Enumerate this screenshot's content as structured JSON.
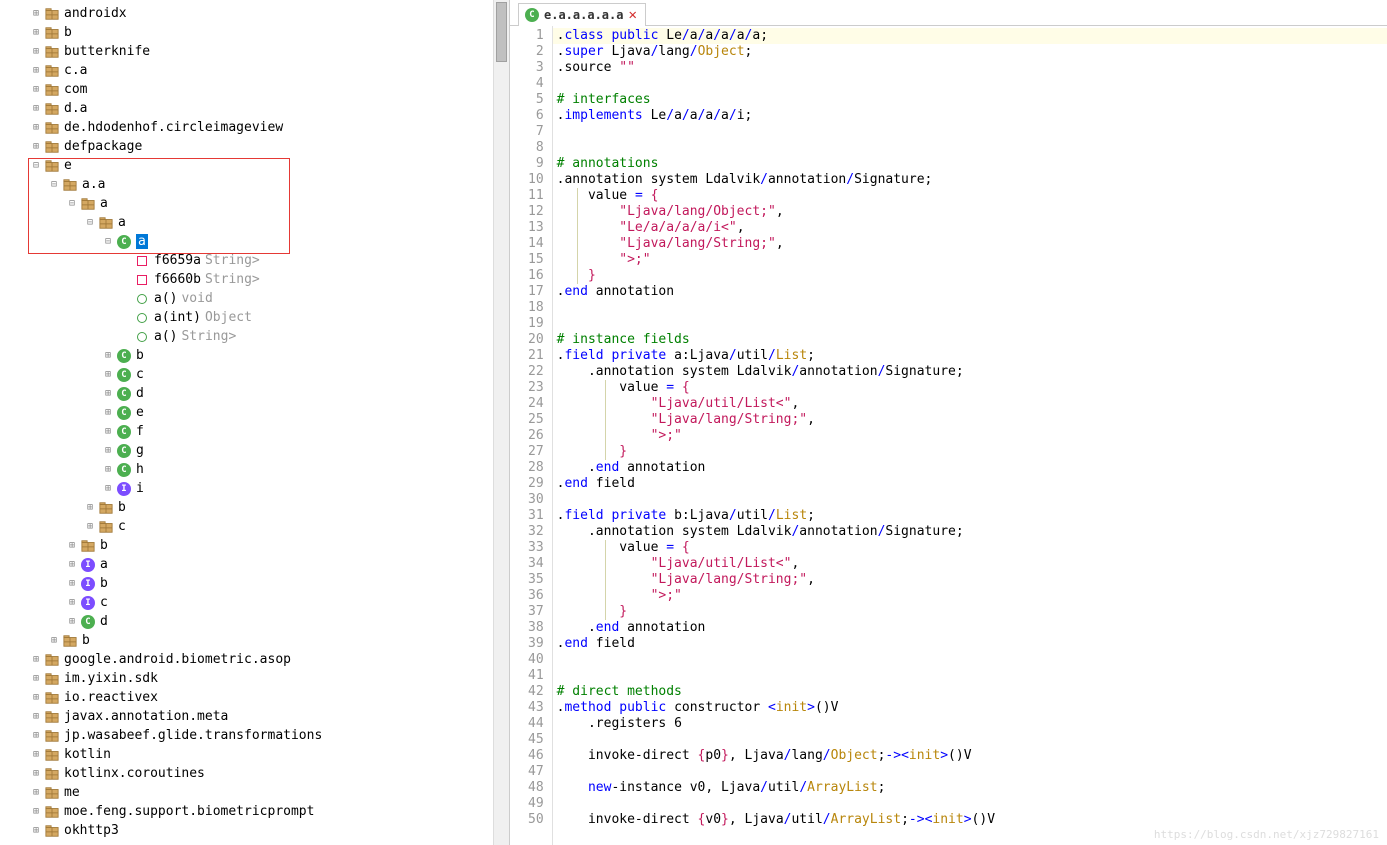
{
  "tree": {
    "top": [
      {
        "label": "androidx",
        "icon": "pkg",
        "exp": "plus"
      },
      {
        "label": "b",
        "icon": "pkg",
        "exp": "plus"
      },
      {
        "label": "butterknife",
        "icon": "pkg",
        "exp": "plus"
      },
      {
        "label": "c.a",
        "icon": "pkg",
        "exp": "plus"
      },
      {
        "label": "com",
        "icon": "pkg",
        "exp": "plus"
      },
      {
        "label": "d.a",
        "icon": "pkg",
        "exp": "plus"
      },
      {
        "label": "de.hdodenhof.circleimageview",
        "icon": "pkg",
        "exp": "plus"
      },
      {
        "label": "defpackage",
        "icon": "pkg",
        "exp": "plus"
      }
    ],
    "e_label": "e",
    "aa_label": "a.a",
    "a1_label": "a",
    "a2_label": "a",
    "a3_label": "a",
    "members": [
      {
        "label": "f6659a",
        "hint": "String>",
        "icon": "field"
      },
      {
        "label": "f6660b",
        "hint": "String>",
        "icon": "field"
      },
      {
        "label": "a()",
        "hint": "void",
        "icon": "method"
      },
      {
        "label": "a(int)",
        "hint": "Object",
        "icon": "method"
      },
      {
        "label": "a()",
        "hint": "String>",
        "icon": "method"
      }
    ],
    "siblings_c": [
      {
        "label": "b",
        "icon": "class"
      },
      {
        "label": "c",
        "icon": "class"
      },
      {
        "label": "d",
        "icon": "class"
      },
      {
        "label": "e",
        "icon": "class"
      },
      {
        "label": "f",
        "icon": "class"
      },
      {
        "label": "g",
        "icon": "class"
      },
      {
        "label": "h",
        "icon": "class"
      },
      {
        "label": "i",
        "icon": "interface"
      }
    ],
    "aa_children_tail": [
      {
        "label": "b",
        "icon": "pkg",
        "exp": "plus"
      },
      {
        "label": "c",
        "icon": "pkg",
        "exp": "plus"
      }
    ],
    "e_children_tail": [
      {
        "label": "b",
        "icon": "pkg",
        "exp": "plus"
      },
      {
        "label": "a",
        "icon": "interface",
        "exp": "plus"
      },
      {
        "label": "b",
        "icon": "interface",
        "exp": "plus"
      },
      {
        "label": "c",
        "icon": "interface",
        "exp": "plus"
      },
      {
        "label": "d",
        "icon": "class",
        "exp": "plus"
      }
    ],
    "root_tail": [
      {
        "label": "b",
        "icon": "pkg",
        "exp": "plus"
      }
    ],
    "bottom": [
      {
        "label": "google.android.biometric.asop",
        "icon": "pkg",
        "exp": "plus"
      },
      {
        "label": "im.yixin.sdk",
        "icon": "pkg",
        "exp": "plus"
      },
      {
        "label": "io.reactivex",
        "icon": "pkg",
        "exp": "plus"
      },
      {
        "label": "javax.annotation.meta",
        "icon": "pkg",
        "exp": "plus"
      },
      {
        "label": "jp.wasabeef.glide.transformations",
        "icon": "pkg",
        "exp": "plus"
      },
      {
        "label": "kotlin",
        "icon": "pkg",
        "exp": "plus"
      },
      {
        "label": "kotlinx.coroutines",
        "icon": "pkg",
        "exp": "plus"
      },
      {
        "label": "me",
        "icon": "pkg",
        "exp": "plus"
      },
      {
        "label": "moe.feng.support.biometricprompt",
        "icon": "pkg",
        "exp": "plus"
      },
      {
        "label": "okhttp3",
        "icon": "pkg",
        "exp": "plus"
      }
    ]
  },
  "tab": {
    "title": "e.a.a.a.a.a"
  },
  "code": [
    {
      "n": 1,
      "hl": true,
      "tokens": [
        {
          "t": ".",
          "c": "punct"
        },
        {
          "t": "class",
          "c": "kw"
        },
        {
          "t": " ",
          "c": ""
        },
        {
          "t": "public",
          "c": "kw"
        },
        {
          "t": " Le",
          "c": ""
        },
        {
          "t": "/",
          "c": "op"
        },
        {
          "t": "a",
          "c": ""
        },
        {
          "t": "/",
          "c": "op"
        },
        {
          "t": "a",
          "c": ""
        },
        {
          "t": "/",
          "c": "op"
        },
        {
          "t": "a",
          "c": ""
        },
        {
          "t": "/",
          "c": "op"
        },
        {
          "t": "a",
          "c": ""
        },
        {
          "t": "/",
          "c": "op"
        },
        {
          "t": "a",
          "c": ""
        },
        {
          "t": ";",
          "c": "punct"
        }
      ]
    },
    {
      "n": 2,
      "tokens": [
        {
          "t": ".",
          "c": "punct"
        },
        {
          "t": "super",
          "c": "kw"
        },
        {
          "t": " Ljava",
          "c": ""
        },
        {
          "t": "/",
          "c": "op"
        },
        {
          "t": "lang",
          "c": ""
        },
        {
          "t": "/",
          "c": "op"
        },
        {
          "t": "Object",
          "c": "typ"
        },
        {
          "t": ";",
          "c": "punct"
        }
      ]
    },
    {
      "n": 3,
      "tokens": [
        {
          "t": ".source ",
          "c": ""
        },
        {
          "t": "\"\"",
          "c": "str"
        }
      ]
    },
    {
      "n": 4,
      "tokens": []
    },
    {
      "n": 5,
      "tokens": [
        {
          "t": "# interfaces",
          "c": "cmt"
        }
      ]
    },
    {
      "n": 6,
      "tokens": [
        {
          "t": ".",
          "c": "punct"
        },
        {
          "t": "implements",
          "c": "kw"
        },
        {
          "t": " Le",
          "c": ""
        },
        {
          "t": "/",
          "c": "op"
        },
        {
          "t": "a",
          "c": ""
        },
        {
          "t": "/",
          "c": "op"
        },
        {
          "t": "a",
          "c": ""
        },
        {
          "t": "/",
          "c": "op"
        },
        {
          "t": "a",
          "c": ""
        },
        {
          "t": "/",
          "c": "op"
        },
        {
          "t": "a",
          "c": ""
        },
        {
          "t": "/",
          "c": "op"
        },
        {
          "t": "i",
          "c": ""
        },
        {
          "t": ";",
          "c": "punct"
        }
      ]
    },
    {
      "n": 7,
      "tokens": []
    },
    {
      "n": 8,
      "tokens": []
    },
    {
      "n": 9,
      "tokens": [
        {
          "t": "# annotations",
          "c": "cmt"
        }
      ]
    },
    {
      "n": 10,
      "tokens": [
        {
          "t": ".annotation system Ldalvik",
          "c": ""
        },
        {
          "t": "/",
          "c": "op"
        },
        {
          "t": "annotation",
          "c": ""
        },
        {
          "t": "/",
          "c": "op"
        },
        {
          "t": "Signature",
          "c": ""
        },
        {
          "t": ";",
          "c": "punct"
        }
      ]
    },
    {
      "n": 11,
      "bar": 24,
      "tokens": [
        {
          "t": "    value ",
          "c": ""
        },
        {
          "t": "=",
          "c": "op"
        },
        {
          "t": " ",
          "c": ""
        },
        {
          "t": "{",
          "c": "str"
        }
      ]
    },
    {
      "n": 12,
      "bar": 24,
      "tokens": [
        {
          "t": "        ",
          "c": ""
        },
        {
          "t": "\"Ljava/lang/Object;\"",
          "c": "str"
        },
        {
          "t": ",",
          "c": "punct"
        }
      ]
    },
    {
      "n": 13,
      "bar": 24,
      "tokens": [
        {
          "t": "        ",
          "c": ""
        },
        {
          "t": "\"Le/a/a/a/a/i<\"",
          "c": "str"
        },
        {
          "t": ",",
          "c": "punct"
        }
      ]
    },
    {
      "n": 14,
      "bar": 24,
      "tokens": [
        {
          "t": "        ",
          "c": ""
        },
        {
          "t": "\"Ljava/lang/String;\"",
          "c": "str"
        },
        {
          "t": ",",
          "c": "punct"
        }
      ]
    },
    {
      "n": 15,
      "bar": 24,
      "tokens": [
        {
          "t": "        ",
          "c": ""
        },
        {
          "t": "\">;\"",
          "c": "str"
        }
      ]
    },
    {
      "n": 16,
      "bar": 24,
      "tokens": [
        {
          "t": "    ",
          "c": ""
        },
        {
          "t": "}",
          "c": "str"
        }
      ]
    },
    {
      "n": 17,
      "tokens": [
        {
          "t": ".",
          "c": "punct"
        },
        {
          "t": "end",
          "c": "kw"
        },
        {
          "t": " annotation",
          "c": ""
        }
      ]
    },
    {
      "n": 18,
      "tokens": []
    },
    {
      "n": 19,
      "tokens": []
    },
    {
      "n": 20,
      "tokens": [
        {
          "t": "# instance fields",
          "c": "cmt"
        }
      ]
    },
    {
      "n": 21,
      "tokens": [
        {
          "t": ".",
          "c": "punct"
        },
        {
          "t": "field",
          "c": "kw"
        },
        {
          "t": " ",
          "c": ""
        },
        {
          "t": "private",
          "c": "kw"
        },
        {
          "t": " a:Ljava",
          "c": ""
        },
        {
          "t": "/",
          "c": "op"
        },
        {
          "t": "util",
          "c": ""
        },
        {
          "t": "/",
          "c": "op"
        },
        {
          "t": "List",
          "c": "typ"
        },
        {
          "t": ";",
          "c": "punct"
        }
      ]
    },
    {
      "n": 22,
      "tokens": [
        {
          "t": "    .annotation system Ldalvik",
          "c": ""
        },
        {
          "t": "/",
          "c": "op"
        },
        {
          "t": "annotation",
          "c": ""
        },
        {
          "t": "/",
          "c": "op"
        },
        {
          "t": "Signature",
          "c": ""
        },
        {
          "t": ";",
          "c": "punct"
        }
      ]
    },
    {
      "n": 23,
      "bar": 52,
      "tokens": [
        {
          "t": "        value ",
          "c": ""
        },
        {
          "t": "=",
          "c": "op"
        },
        {
          "t": " ",
          "c": ""
        },
        {
          "t": "{",
          "c": "str"
        }
      ]
    },
    {
      "n": 24,
      "bar": 52,
      "tokens": [
        {
          "t": "            ",
          "c": ""
        },
        {
          "t": "\"Ljava/util/List<\"",
          "c": "str"
        },
        {
          "t": ",",
          "c": "punct"
        }
      ]
    },
    {
      "n": 25,
      "bar": 52,
      "tokens": [
        {
          "t": "            ",
          "c": ""
        },
        {
          "t": "\"Ljava/lang/String;\"",
          "c": "str"
        },
        {
          "t": ",",
          "c": "punct"
        }
      ]
    },
    {
      "n": 26,
      "bar": 52,
      "tokens": [
        {
          "t": "            ",
          "c": ""
        },
        {
          "t": "\">;\"",
          "c": "str"
        }
      ]
    },
    {
      "n": 27,
      "bar": 52,
      "tokens": [
        {
          "t": "        ",
          "c": ""
        },
        {
          "t": "}",
          "c": "str"
        }
      ]
    },
    {
      "n": 28,
      "tokens": [
        {
          "t": "    .",
          "c": ""
        },
        {
          "t": "end",
          "c": "kw"
        },
        {
          "t": " annotation",
          "c": ""
        }
      ]
    },
    {
      "n": 29,
      "tokens": [
        {
          "t": ".",
          "c": "punct"
        },
        {
          "t": "end",
          "c": "kw"
        },
        {
          "t": " field",
          "c": ""
        }
      ]
    },
    {
      "n": 30,
      "tokens": []
    },
    {
      "n": 31,
      "tokens": [
        {
          "t": ".",
          "c": "punct"
        },
        {
          "t": "field",
          "c": "kw"
        },
        {
          "t": " ",
          "c": ""
        },
        {
          "t": "private",
          "c": "kw"
        },
        {
          "t": " b:Ljava",
          "c": ""
        },
        {
          "t": "/",
          "c": "op"
        },
        {
          "t": "util",
          "c": ""
        },
        {
          "t": "/",
          "c": "op"
        },
        {
          "t": "List",
          "c": "typ"
        },
        {
          "t": ";",
          "c": "punct"
        }
      ]
    },
    {
      "n": 32,
      "tokens": [
        {
          "t": "    .annotation system Ldalvik",
          "c": ""
        },
        {
          "t": "/",
          "c": "op"
        },
        {
          "t": "annotation",
          "c": ""
        },
        {
          "t": "/",
          "c": "op"
        },
        {
          "t": "Signature",
          "c": ""
        },
        {
          "t": ";",
          "c": "punct"
        }
      ]
    },
    {
      "n": 33,
      "bar": 52,
      "tokens": [
        {
          "t": "        value ",
          "c": ""
        },
        {
          "t": "=",
          "c": "op"
        },
        {
          "t": " ",
          "c": ""
        },
        {
          "t": "{",
          "c": "str"
        }
      ]
    },
    {
      "n": 34,
      "bar": 52,
      "tokens": [
        {
          "t": "            ",
          "c": ""
        },
        {
          "t": "\"Ljava/util/List<\"",
          "c": "str"
        },
        {
          "t": ",",
          "c": "punct"
        }
      ]
    },
    {
      "n": 35,
      "bar": 52,
      "tokens": [
        {
          "t": "            ",
          "c": ""
        },
        {
          "t": "\"Ljava/lang/String;\"",
          "c": "str"
        },
        {
          "t": ",",
          "c": "punct"
        }
      ]
    },
    {
      "n": 36,
      "bar": 52,
      "tokens": [
        {
          "t": "            ",
          "c": ""
        },
        {
          "t": "\">;\"",
          "c": "str"
        }
      ]
    },
    {
      "n": 37,
      "bar": 52,
      "tokens": [
        {
          "t": "        ",
          "c": ""
        },
        {
          "t": "}",
          "c": "str"
        }
      ]
    },
    {
      "n": 38,
      "tokens": [
        {
          "t": "    .",
          "c": ""
        },
        {
          "t": "end",
          "c": "kw"
        },
        {
          "t": " annotation",
          "c": ""
        }
      ]
    },
    {
      "n": 39,
      "tokens": [
        {
          "t": ".",
          "c": "punct"
        },
        {
          "t": "end",
          "c": "kw"
        },
        {
          "t": " field",
          "c": ""
        }
      ]
    },
    {
      "n": 40,
      "tokens": []
    },
    {
      "n": 41,
      "tokens": []
    },
    {
      "n": 42,
      "tokens": [
        {
          "t": "# direct methods",
          "c": "cmt"
        }
      ]
    },
    {
      "n": 43,
      "tokens": [
        {
          "t": ".",
          "c": "punct"
        },
        {
          "t": "method",
          "c": "kw"
        },
        {
          "t": " ",
          "c": ""
        },
        {
          "t": "public",
          "c": "kw"
        },
        {
          "t": " constructor ",
          "c": ""
        },
        {
          "t": "<",
          "c": "op"
        },
        {
          "t": "init",
          "c": "typ"
        },
        {
          "t": ">",
          "c": "op"
        },
        {
          "t": "()",
          "c": "punct"
        },
        {
          "t": "V",
          "c": ""
        }
      ]
    },
    {
      "n": 44,
      "tokens": [
        {
          "t": "    .registers ",
          "c": ""
        },
        {
          "t": "6",
          "c": "num"
        }
      ]
    },
    {
      "n": 45,
      "tokens": []
    },
    {
      "n": 46,
      "tokens": [
        {
          "t": "    invoke-direct ",
          "c": ""
        },
        {
          "t": "{",
          "c": "str"
        },
        {
          "t": "p0",
          "c": ""
        },
        {
          "t": "}",
          "c": "str"
        },
        {
          "t": ", Ljava",
          "c": ""
        },
        {
          "t": "/",
          "c": "op"
        },
        {
          "t": "lang",
          "c": ""
        },
        {
          "t": "/",
          "c": "op"
        },
        {
          "t": "Object",
          "c": "typ"
        },
        {
          "t": ";",
          "c": "punct"
        },
        {
          "t": "->",
          "c": "op"
        },
        {
          "t": "<",
          "c": "op"
        },
        {
          "t": "init",
          "c": "typ"
        },
        {
          "t": ">",
          "c": "op"
        },
        {
          "t": "()",
          "c": "punct"
        },
        {
          "t": "V",
          "c": ""
        }
      ]
    },
    {
      "n": 47,
      "tokens": []
    },
    {
      "n": 48,
      "tokens": [
        {
          "t": "    ",
          "c": ""
        },
        {
          "t": "new",
          "c": "kw"
        },
        {
          "t": "-instance v0, Ljava",
          "c": ""
        },
        {
          "t": "/",
          "c": "op"
        },
        {
          "t": "util",
          "c": ""
        },
        {
          "t": "/",
          "c": "op"
        },
        {
          "t": "ArrayList",
          "c": "typ"
        },
        {
          "t": ";",
          "c": "punct"
        }
      ]
    },
    {
      "n": 49,
      "tokens": []
    },
    {
      "n": 50,
      "tokens": [
        {
          "t": "    invoke-direct ",
          "c": ""
        },
        {
          "t": "{",
          "c": "str"
        },
        {
          "t": "v0",
          "c": ""
        },
        {
          "t": "}",
          "c": "str"
        },
        {
          "t": ", Ljava",
          "c": ""
        },
        {
          "t": "/",
          "c": "op"
        },
        {
          "t": "util",
          "c": ""
        },
        {
          "t": "/",
          "c": "op"
        },
        {
          "t": "ArrayList",
          "c": "typ"
        },
        {
          "t": ";",
          "c": "punct"
        },
        {
          "t": "->",
          "c": "op"
        },
        {
          "t": "<",
          "c": "op"
        },
        {
          "t": "init",
          "c": "typ"
        },
        {
          "t": ">",
          "c": "op"
        },
        {
          "t": "()",
          "c": "punct"
        },
        {
          "t": "V",
          "c": ""
        }
      ]
    }
  ],
  "watermark": "https://blog.csdn.net/xjz729827161"
}
